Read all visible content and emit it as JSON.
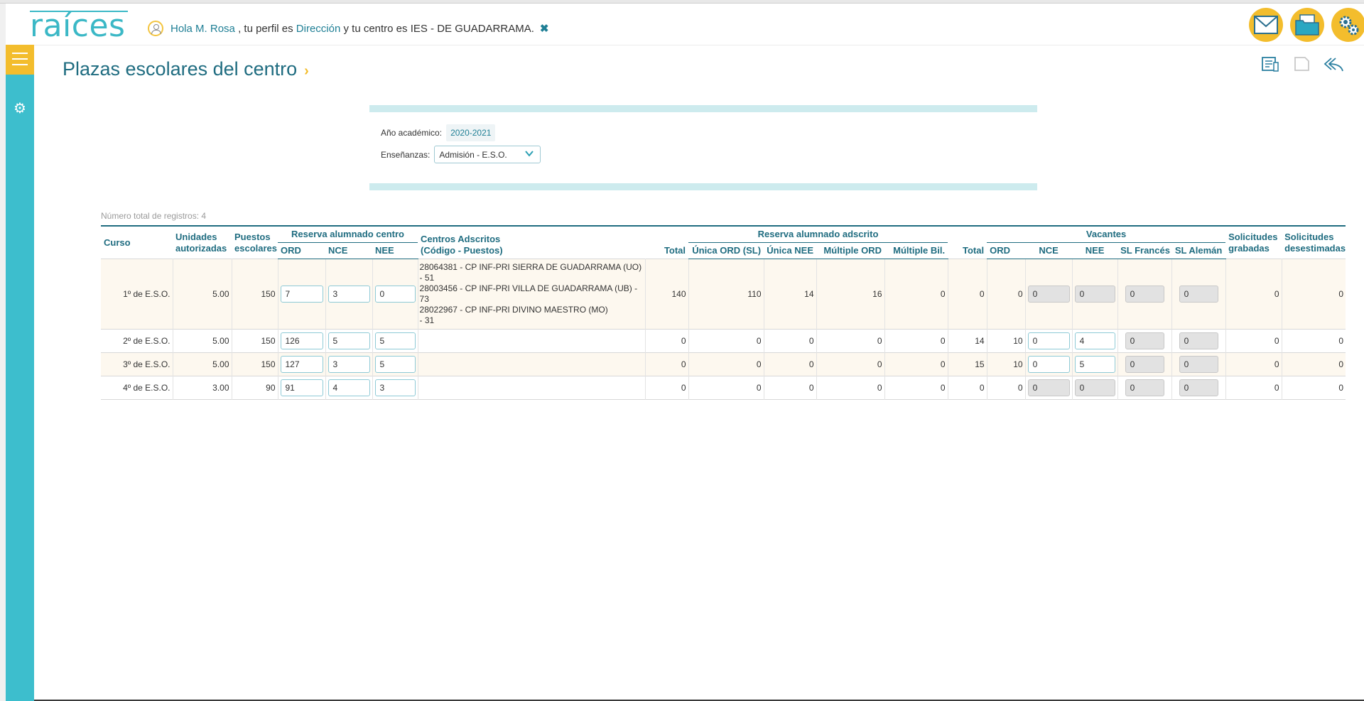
{
  "header": {
    "logo": "raíces",
    "greeting_prefix": "Hola",
    "user_name": "M. Rosa",
    "profile_text": ", tu perfil es",
    "profile": "Dirección",
    "center_text": "y tu centro es",
    "center": "IES - DE GUADARRAMA.",
    "icons": [
      "mail-icon",
      "folder-icon",
      "gear-icon"
    ]
  },
  "page": {
    "title": "Plazas escolares del centro",
    "tool_icons": [
      "report-icon",
      "document-icon",
      "back-icon"
    ]
  },
  "filters": {
    "year_label": "Año académico:",
    "year_value": "2020-2021",
    "teaching_label": "Enseñanzas:",
    "teaching_value": "Admisión - E.S.O."
  },
  "table": {
    "count_label": "Número total de registros: 4",
    "headers": {
      "curso": "Curso",
      "unidades_1": "Unidades",
      "unidades_2": "autorizadas",
      "puestos_1": "Puestos",
      "puestos_2": "escolares",
      "reserva_centro": "Reserva alumnado centro",
      "centros_1": "Centros Adscritos",
      "centros_2": "(Código - Puestos)",
      "total": "Total",
      "reserva_adscrito": "Reserva alumnado adscrito",
      "vacantes": "Vacantes",
      "solic_grab_1": "Solicitudes",
      "solic_grab_2": "grabadas",
      "solic_des_1": "Solicitudes",
      "solic_des_2": "desestimadas",
      "ord": "ORD",
      "nce": "NCE",
      "nee": "NEE",
      "unica_ord": "Única ORD (SL)",
      "unica_nee": "Única NEE",
      "multiple_ord": "Múltiple ORD",
      "multiple_bil": "Múltiple Bil.",
      "total2": "Total",
      "v_ord": "ORD",
      "v_nce": "NCE",
      "v_nee": "NEE",
      "sl_frances": "SL Francés",
      "sl_aleman": "SL Alemán"
    },
    "rows": [
      {
        "curso": "1º de E.S.O.",
        "unidades": "5.00",
        "puestos": "150",
        "ord": "7",
        "nce": "3",
        "nee": "0",
        "adscritos": [
          "28064381 - CP INF-PRI SIERRA DE GUADARRAMA (UO) - 51",
          "28003456 - CP INF-PRI VILLA DE GUADARRAMA (UB) - 73",
          "28022967 - CP INF-PRI DIVINO MAESTRO (MO)",
          "- 31"
        ],
        "total": "140",
        "unica_ord": "110",
        "unica_nee": "14",
        "multiple_ord": "16",
        "multiple_bil": "0",
        "total2": "0",
        "v_ord": "0",
        "v_nce": "0",
        "v_nee": "0",
        "sl_frances": "0",
        "sl_aleman": "0",
        "solic_grab": "0",
        "solic_des": "0"
      },
      {
        "curso": "2º de E.S.O.",
        "unidades": "5.00",
        "puestos": "150",
        "ord": "126",
        "nce": "5",
        "nee": "5",
        "adscritos": [
          "",
          "",
          "",
          ""
        ],
        "total": "0",
        "unica_ord": "0",
        "unica_nee": "0",
        "multiple_ord": "0",
        "multiple_bil": "0",
        "total2": "14",
        "v_ord": "10",
        "v_nce": "0",
        "v_nee": "4",
        "sl_frances": "0",
        "sl_aleman": "0",
        "solic_grab": "0",
        "solic_des": "0"
      },
      {
        "curso": "3º de E.S.O.",
        "unidades": "5.00",
        "puestos": "150",
        "ord": "127",
        "nce": "3",
        "nee": "5",
        "adscritos": [
          "",
          "",
          "",
          ""
        ],
        "total": "0",
        "unica_ord": "0",
        "unica_nee": "0",
        "multiple_ord": "0",
        "multiple_bil": "0",
        "total2": "15",
        "v_ord": "10",
        "v_nce": "0",
        "v_nee": "5",
        "sl_frances": "0",
        "sl_aleman": "0",
        "solic_grab": "0",
        "solic_des": "0"
      },
      {
        "curso": "4º de E.S.O.",
        "unidades": "3.00",
        "puestos": "90",
        "ord": "91",
        "nce": "4",
        "nee": "3",
        "adscritos": [
          "",
          "",
          "",
          ""
        ],
        "total": "0",
        "unica_ord": "0",
        "unica_nee": "0",
        "multiple_ord": "0",
        "multiple_bil": "0",
        "total2": "0",
        "v_ord": "0",
        "v_nce": "0",
        "v_nee": "0",
        "sl_frances": "0",
        "sl_aleman": "0",
        "solic_grab": "0",
        "solic_des": "0"
      }
    ]
  }
}
